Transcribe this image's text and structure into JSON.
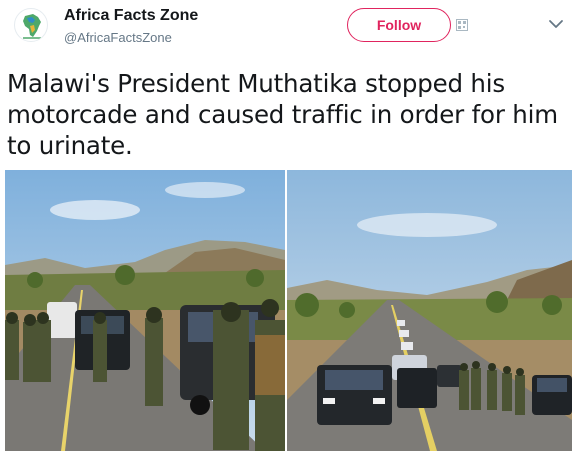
{
  "account": {
    "display_name": "Africa Facts Zone",
    "handle": "@AfricaFactsZone",
    "avatar_icon": "africa-map-logo-icon"
  },
  "actions": {
    "follow_label": "Follow",
    "menu_icon": "chevron-down-icon",
    "qr_icon": "qr-code-icon"
  },
  "tweet": {
    "text": "Malawi's President Muthatika stopped his motorcade and caused traffic in order for him to urinate."
  },
  "media": {
    "photos": [
      {
        "subject": "soldiers-standing-by-motorcade-on-road"
      },
      {
        "subject": "motorcade-vehicles-stopped-on-road"
      }
    ]
  },
  "colors": {
    "follow_accent": "#e0245e",
    "text_primary": "#14171a",
    "text_secondary": "#657786"
  }
}
